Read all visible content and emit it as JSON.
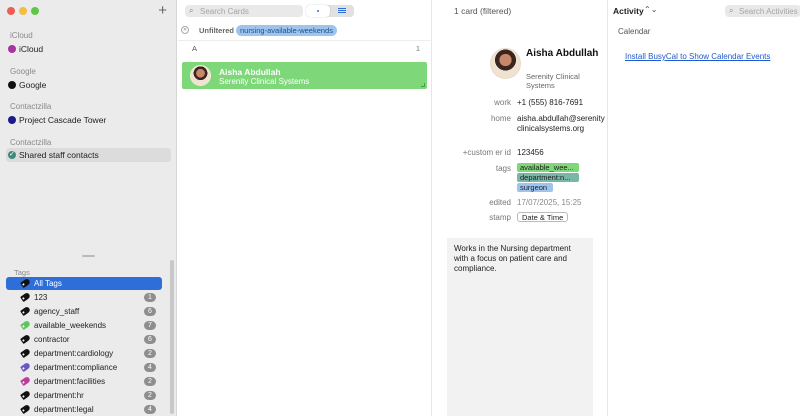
{
  "sidebar": {
    "add_label": "+",
    "sources": [
      {
        "header": "iCloud",
        "item": "iCloud",
        "color": "#a8349c"
      },
      {
        "header": "Google",
        "item": "Google",
        "color": "#111111"
      },
      {
        "header": "Contactzilla",
        "item": "Project Cascade Tower",
        "color": "#1a1a8a"
      },
      {
        "header": "Contactzilla",
        "item": "Shared staff contacts",
        "color": "#3e8b7a",
        "selected": true
      }
    ],
    "tags_header": "Tags",
    "tags": [
      {
        "label": "All Tags",
        "count": "",
        "color": "#111111",
        "selected": true
      },
      {
        "label": "123",
        "count": "1",
        "color": "#111111"
      },
      {
        "label": "agency_staff",
        "count": "6",
        "color": "#111111"
      },
      {
        "label": "available_weekends",
        "count": "7",
        "color": "#5cc65a"
      },
      {
        "label": "contractor",
        "count": "6",
        "color": "#111111"
      },
      {
        "label": "department:cardiology",
        "count": "2",
        "color": "#111111"
      },
      {
        "label": "department:compliance",
        "count": "4",
        "color": "#6a55c9"
      },
      {
        "label": "department:facilities",
        "count": "2",
        "color": "#c0399a"
      },
      {
        "label": "department:hr",
        "count": "2",
        "color": "#111111"
      },
      {
        "label": "department:legal",
        "count": "4",
        "color": "#111111"
      }
    ]
  },
  "list": {
    "search_placeholder": "Search Cards",
    "card_count": "1 card (filtered)",
    "unfiltered_label": "Unfiltered",
    "filter_tag": "nursing-available-weekends",
    "section_letter": "A",
    "section_count": "1",
    "card": {
      "name": "Aisha Abdullah",
      "company": "Serenity Clinical Systems",
      "color": "#7ed87a"
    }
  },
  "detail": {
    "name": "Aisha Abdullah",
    "company": "Serenity Clinical Systems",
    "work_label": "work",
    "work_value": "+1 (555) 816-7691",
    "home_label": "home",
    "home_value": "aisha.abdullah@serenityclinicalsystems.org",
    "custom_label": "+custom er id",
    "custom_value": "123456",
    "tags_label": "tags",
    "tags": [
      "available_wee...",
      "department:n...",
      "surgeon"
    ],
    "edited_label": "edited",
    "edited_value": "17/07/2025, 15:25",
    "stamp_label": "stamp",
    "stamp_button": "Date & Time",
    "notes": "Works in the Nursing department with a focus on patient care and compliance."
  },
  "activity": {
    "title": "Activity",
    "chevron": "⌃⌄",
    "search_placeholder": "Search Activities",
    "calendar_label": "Calendar",
    "busycal_link": "Install BusyCal to Show Calendar Events"
  }
}
